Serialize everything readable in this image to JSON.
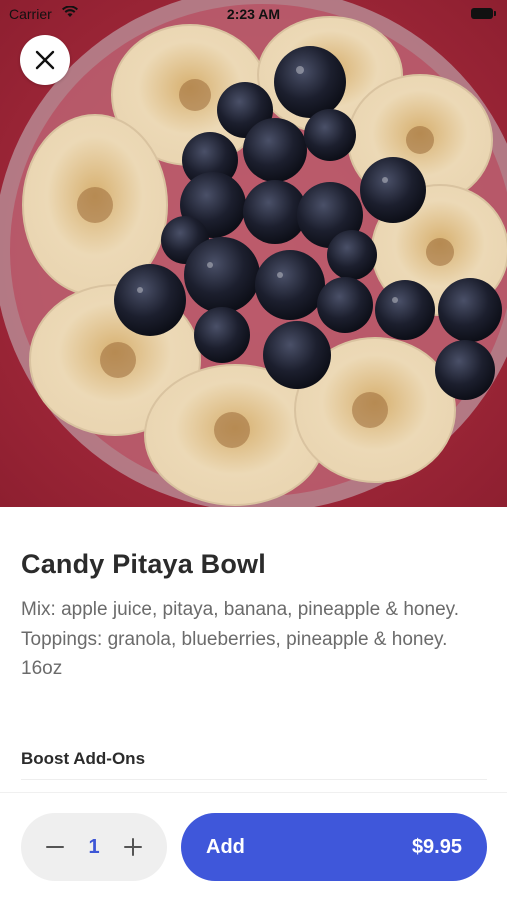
{
  "status_bar": {
    "carrier": "Carrier",
    "time": "2:23 AM"
  },
  "hero": {
    "icon": "photo-of-bowl-banana-blueberries"
  },
  "product": {
    "name": "Candy Pitaya Bowl",
    "description_lines": [
      "Mix: apple juice, pitaya, banana, pineapple & honey.",
      "Toppings: granola, blueberries, pineapple & honey.",
      "16oz"
    ]
  },
  "addons": {
    "title": "Boost Add-Ons"
  },
  "order": {
    "quantity": "1",
    "add_label": "Add",
    "price": "$9.95"
  },
  "colors": {
    "accent": "#3f57da",
    "stepper_bg": "#efefef",
    "title": "#2b2b2b",
    "body_text": "#6b6b6b"
  }
}
